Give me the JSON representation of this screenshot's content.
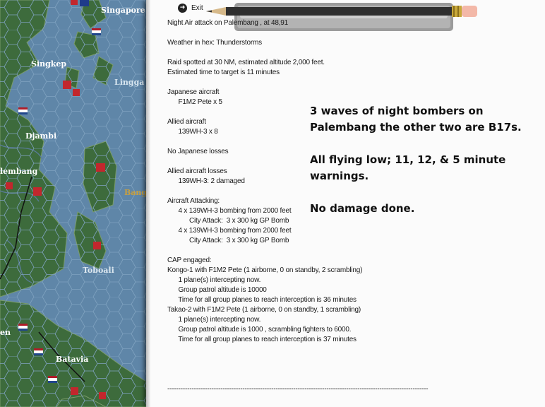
{
  "map": {
    "places": [
      {
        "name": "Singapore",
        "color": "#ffffff"
      },
      {
        "name": "Singkep",
        "color": "#ffffff"
      },
      {
        "name": "Lingga",
        "color": "#d8e6f0"
      },
      {
        "name": "Djambi",
        "color": "#ffffff"
      },
      {
        "name": "lembang",
        "color": "#ffffff"
      },
      {
        "name": "Bang",
        "color": "#c8a040"
      },
      {
        "name": "Toboali",
        "color": "#dde8f0"
      },
      {
        "name": "en",
        "color": "#ffffff"
      },
      {
        "name": "Batavia",
        "color": "#ffffff"
      }
    ],
    "colors": {
      "sea": "#5f86a8",
      "land": "#3d6b3c",
      "hexgrid": "#7fa2c0"
    }
  },
  "exit": {
    "label": "Exit",
    "icon": "exit-arrow-icon"
  },
  "pencil": {
    "icon": "pencil-icon"
  },
  "log": [
    "Night Air attack on Palembang , at 48,91",
    "",
    "Weather in hex: Thunderstorms",
    "",
    "Raid spotted at 30 NM, estimated altitude 2,000 feet.",
    "Estimated time to target is 11 minutes",
    "",
    "Japanese aircraft",
    "      F1M2 Pete x 5",
    "",
    "Allied aircraft",
    "      139WH-3 x 8",
    "",
    "No Japanese losses",
    "",
    "Allied aircraft losses",
    "      139WH-3: 2 damaged",
    "",
    "Aircraft Attacking:",
    "      4 x 139WH-3 bombing from 2000 feet",
    "            City Attack:  3 x 300 kg GP Bomb",
    "      4 x 139WH-3 bombing from 2000 feet",
    "            City Attack:  3 x 300 kg GP Bomb",
    "",
    "CAP engaged:",
    "Kongo-1 with F1M2 Pete (1 airborne, 0 on standby, 2 scrambling)",
    "      1 plane(s) intercepting now.",
    "      Group patrol altitude is 10000",
    "      Time for all group planes to reach interception is 36 minutes",
    "Takao-2 with F1M2 Pete (1 airborne, 0 on standby, 1 scrambling)",
    "      1 plane(s) intercepting now.",
    "      Group patrol altitude is 1000 , scrambling fighters to 6000.",
    "      Time for all group planes to reach interception is 37 minutes",
    "",
    "",
    "",
    "",
    "----------------------------------------------------------------------------------------------------------------------"
  ],
  "note": [
    "3 waves of night bombers on",
    "Palembang the other two are B17s.",
    "",
    "All flying low; 11, 12, & 5 minute",
    "warnings.",
    "",
    "No damage done."
  ]
}
